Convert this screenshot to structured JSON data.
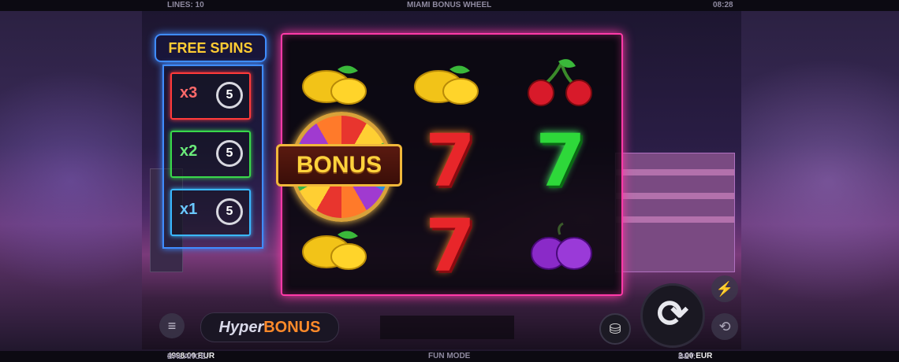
{
  "top_bar": {
    "lines": "LINES: 10",
    "game_title": "MIAMI BONUS WHEEL",
    "clock": "08:28"
  },
  "free_spins": {
    "title": "FREE SPINS",
    "rows": [
      {
        "multiplier": "x3",
        "spins": "5",
        "color": "#ff3a3a"
      },
      {
        "multiplier": "x2",
        "spins": "5",
        "color": "#39d84a"
      },
      {
        "multiplier": "x1",
        "spins": "5",
        "color": "#3ab8ff"
      }
    ]
  },
  "reels": {
    "columns": [
      [
        "lemon",
        "bonus-wheel",
        "lemon"
      ],
      [
        "lemon",
        "red-seven",
        "red-seven"
      ],
      [
        "cherry",
        "green-seven",
        "plum"
      ]
    ],
    "bonus_label": "BONUS",
    "seven_glyph": "7"
  },
  "controls": {
    "menu_icon": "≡",
    "hyper_bonus_a": "Hyper",
    "hyper_bonus_b": "BONUS",
    "coin_icon": "⛁",
    "spin_icon": "⟳",
    "turbo_icon": "⚡",
    "autoplay_icon": "⟲"
  },
  "bottom_bar": {
    "balance_label": "BALANCE:",
    "balance_value": "4998.00 EUR",
    "mode": "FUN MODE",
    "bet_label": "BET:",
    "bet_value": "2.00 EUR"
  },
  "colors": {
    "reel_border": "#ff3aa8",
    "panel_border": "#3f8cff",
    "gold": "#ffcc33"
  }
}
